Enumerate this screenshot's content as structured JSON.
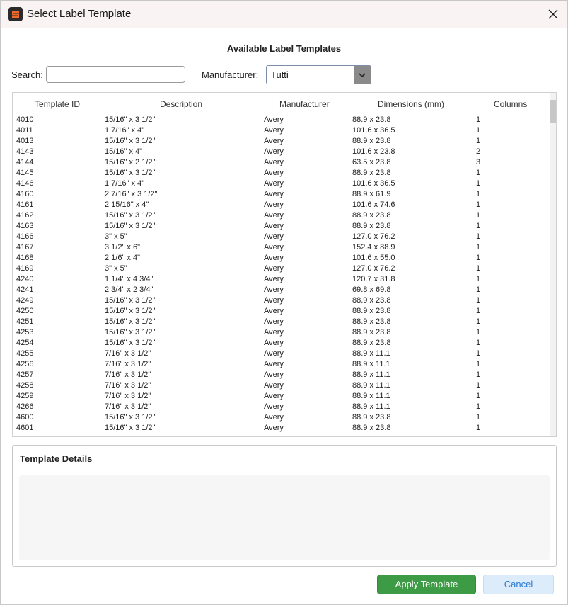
{
  "window": {
    "title": "Select Label Template",
    "app_icon": "app-logo-icon",
    "close_icon": "close-icon"
  },
  "heading": "Available Label Templates",
  "search": {
    "label": "Search:",
    "value": "",
    "placeholder": ""
  },
  "manufacturer": {
    "label": "Manufacturer:",
    "selected": "Tutti",
    "arrow_icon": "chevron-down-icon"
  },
  "table": {
    "columns": [
      "Template ID",
      "Description",
      "Manufacturer",
      "Dimensions (mm)",
      "Columns"
    ],
    "rows": [
      [
        "4010",
        "15/16\" x 3 1/2\"",
        "Avery",
        "88.9 x 23.8",
        "1"
      ],
      [
        "4011",
        "1 7/16\" x 4\"",
        "Avery",
        "101.6 x 36.5",
        "1"
      ],
      [
        "4013",
        "15/16\" x 3 1/2\"",
        "Avery",
        "88.9 x 23.8",
        "1"
      ],
      [
        "4143",
        "15/16\" x 4\"",
        "Avery",
        "101.6 x 23.8",
        "2"
      ],
      [
        "4144",
        "15/16\" x 2 1/2\"",
        "Avery",
        "63.5 x 23.8",
        "3"
      ],
      [
        "4145",
        "15/16\" x 3 1/2\"",
        "Avery",
        "88.9 x 23.8",
        "1"
      ],
      [
        "4146",
        "1 7/16\" x 4\"",
        "Avery",
        "101.6 x 36.5",
        "1"
      ],
      [
        "4160",
        "2 7/16\" x 3 1/2\"",
        "Avery",
        "88.9 x 61.9",
        "1"
      ],
      [
        "4161",
        "2 15/16\" x 4\"",
        "Avery",
        "101.6 x 74.6",
        "1"
      ],
      [
        "4162",
        "15/16\" x 3 1/2\"",
        "Avery",
        "88.9 x 23.8",
        "1"
      ],
      [
        "4163",
        "15/16\" x 3 1/2\"",
        "Avery",
        "88.9 x 23.8",
        "1"
      ],
      [
        "4166",
        "3\" x 5\"",
        "Avery",
        "127.0 x 76.2",
        "1"
      ],
      [
        "4167",
        "3 1/2\" x 6\"",
        "Avery",
        "152.4 x 88.9",
        "1"
      ],
      [
        "4168",
        "2 1/6\" x 4\"",
        "Avery",
        "101.6 x 55.0",
        "1"
      ],
      [
        "4169",
        "3\" x 5\"",
        "Avery",
        "127.0 x 76.2",
        "1"
      ],
      [
        "4240",
        "1 1/4\" x 4 3/4\"",
        "Avery",
        "120.7 x 31.8",
        "1"
      ],
      [
        "4241",
        "2 3/4\" x 2 3/4\"",
        "Avery",
        "69.8 x 69.8",
        "1"
      ],
      [
        "4249",
        "15/16\" x 3 1/2\"",
        "Avery",
        "88.9 x 23.8",
        "1"
      ],
      [
        "4250",
        "15/16\" x 3 1/2\"",
        "Avery",
        "88.9 x 23.8",
        "1"
      ],
      [
        "4251",
        "15/16\" x 3 1/2\"",
        "Avery",
        "88.9 x 23.8",
        "1"
      ],
      [
        "4253",
        "15/16\" x 3 1/2\"",
        "Avery",
        "88.9 x 23.8",
        "1"
      ],
      [
        "4254",
        "15/16\" x 3 1/2\"",
        "Avery",
        "88.9 x 23.8",
        "1"
      ],
      [
        "4255",
        "7/16\" x 3 1/2\"",
        "Avery",
        "88.9 x 11.1",
        "1"
      ],
      [
        "4256",
        "7/16\" x 3 1/2\"",
        "Avery",
        "88.9 x 11.1",
        "1"
      ],
      [
        "4257",
        "7/16\" x 3 1/2\"",
        "Avery",
        "88.9 x 11.1",
        "1"
      ],
      [
        "4258",
        "7/16\" x 3 1/2\"",
        "Avery",
        "88.9 x 11.1",
        "1"
      ],
      [
        "4259",
        "7/16\" x 3 1/2\"",
        "Avery",
        "88.9 x 11.1",
        "1"
      ],
      [
        "4266",
        "7/16\" x 3 1/2\"",
        "Avery",
        "88.9 x 11.1",
        "1"
      ],
      [
        "4600",
        "15/16\" x 3 1/2\"",
        "Avery",
        "88.9 x 23.8",
        "1"
      ],
      [
        "4601",
        "15/16\" x 3 1/2\"",
        "Avery",
        "88.9 x 23.8",
        "1"
      ]
    ]
  },
  "details": {
    "title": "Template Details"
  },
  "buttons": {
    "apply": "Apply Template",
    "cancel": "Cancel"
  }
}
